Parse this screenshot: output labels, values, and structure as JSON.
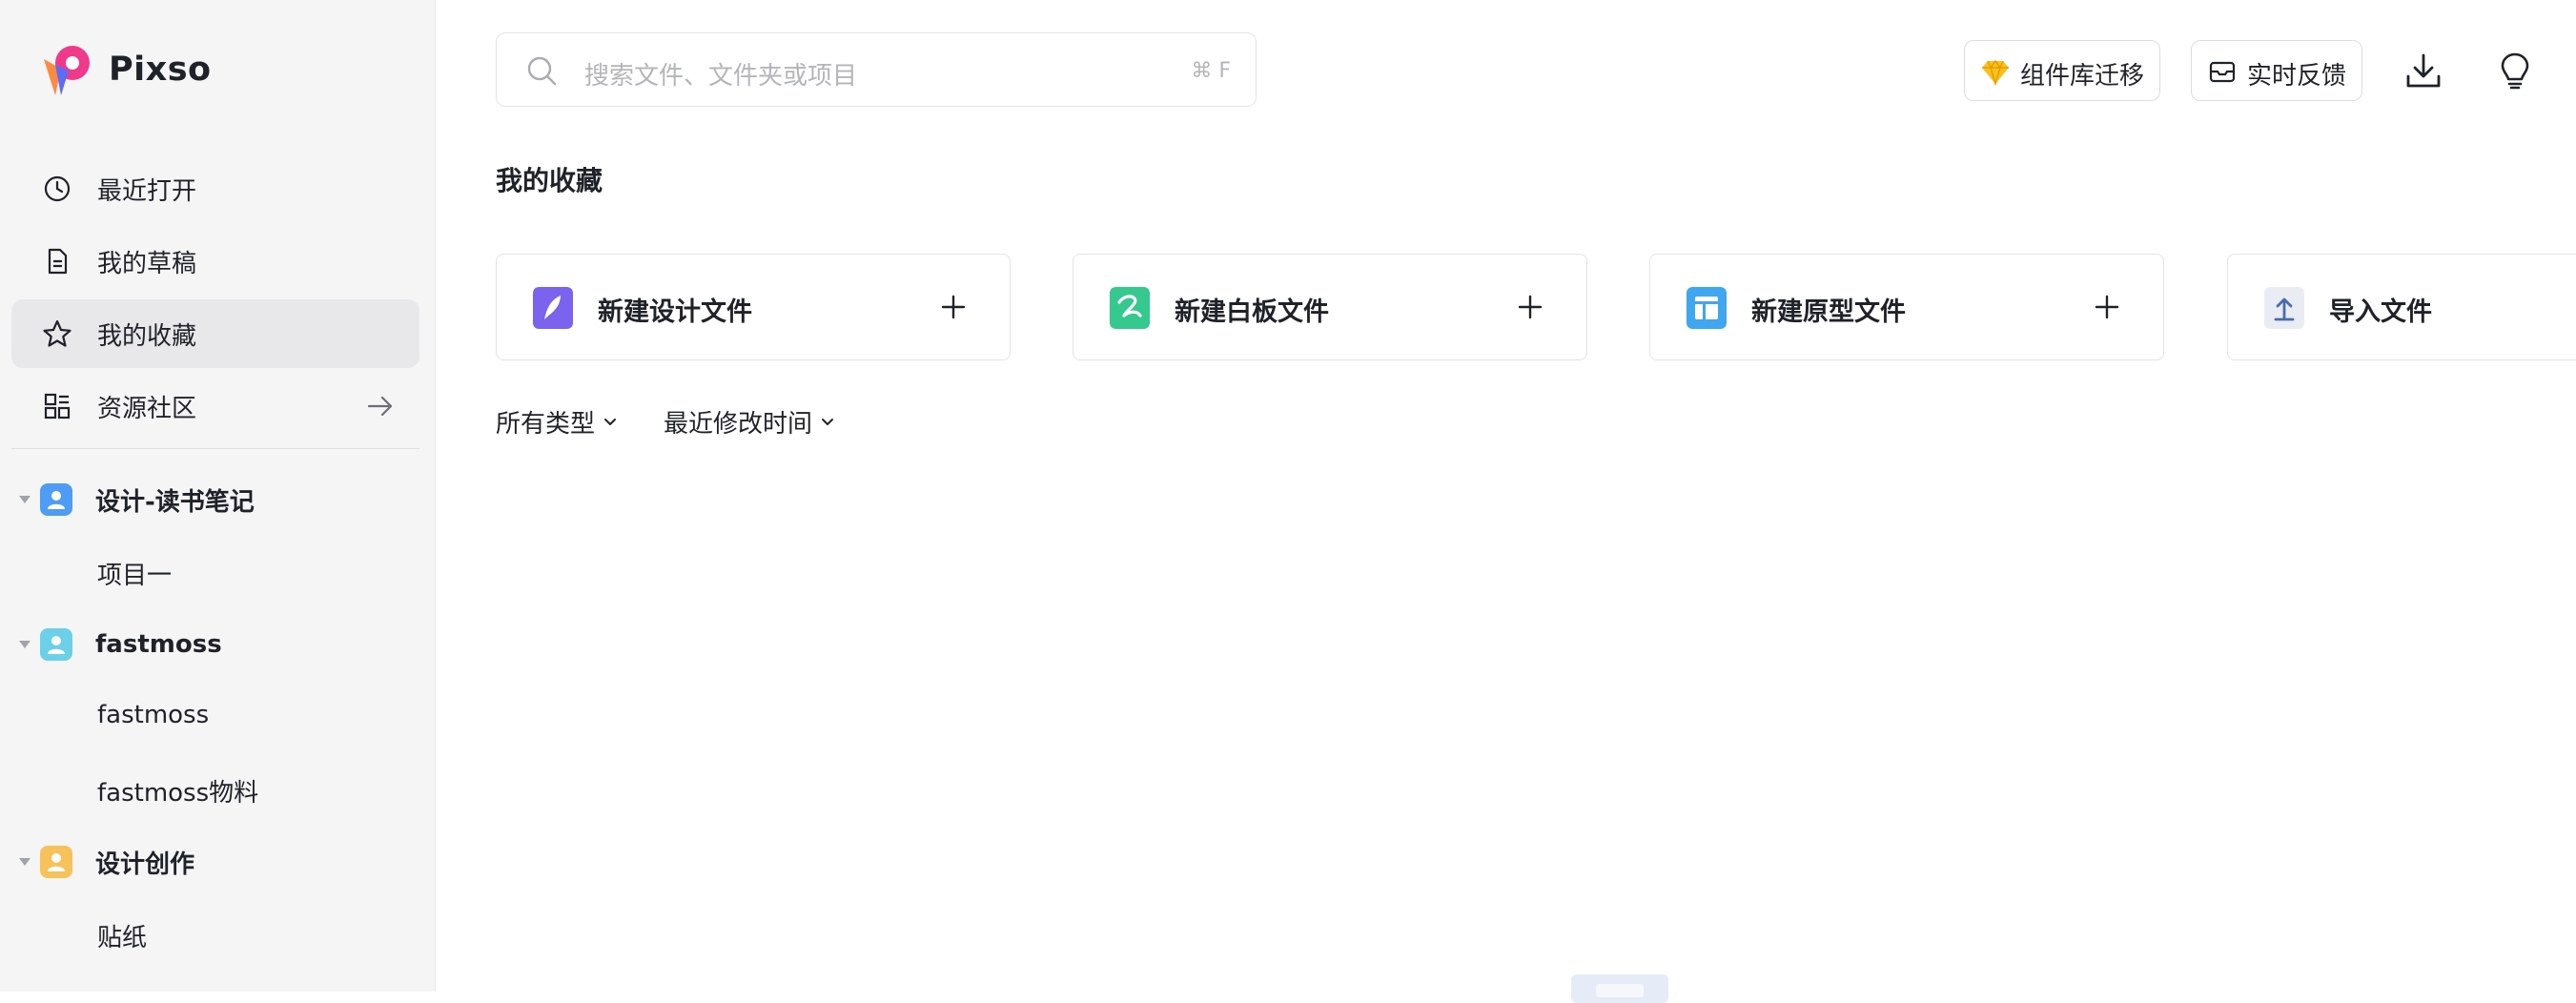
{
  "app": {
    "name": "Pixso"
  },
  "sidebar": {
    "nav": [
      {
        "label": "最近打开",
        "icon": "clock-icon"
      },
      {
        "label": "我的草稿",
        "icon": "draft-icon"
      },
      {
        "label": "我的收藏",
        "icon": "star-icon",
        "active": true
      },
      {
        "label": "资源社区",
        "icon": "grid-icon"
      }
    ],
    "teams": [
      {
        "label": "设计-读书笔记",
        "color": "#4e9cf5",
        "projects": [
          "项目一"
        ]
      },
      {
        "label": "fastmoss",
        "color": "#6cd0e8",
        "projects": [
          "fastmoss",
          "fastmoss物料"
        ]
      },
      {
        "label": "设计创作",
        "color": "#f8c25a",
        "projects": [
          "贴纸"
        ]
      }
    ]
  },
  "search": {
    "placeholder": "搜索文件、文件夹或项目",
    "shortcut": "⌘ F"
  },
  "toolbar": {
    "component_migrate": "组件库迁移",
    "feedback": "实时反馈"
  },
  "main": {
    "title": "我的收藏",
    "cards": [
      {
        "label": "新建设计文件",
        "icon": "design-file-icon",
        "color": "#7b63f0"
      },
      {
        "label": "新建白板文件",
        "icon": "whiteboard-file-icon",
        "color": "#35c98f"
      },
      {
        "label": "新建原型文件",
        "icon": "prototype-file-icon",
        "color": "#3fa6f2"
      },
      {
        "label": "导入文件",
        "icon": "import-file-icon",
        "color": "#e9ecf2"
      }
    ],
    "filters": {
      "type": "所有类型",
      "sort": "最近修改时间"
    }
  }
}
